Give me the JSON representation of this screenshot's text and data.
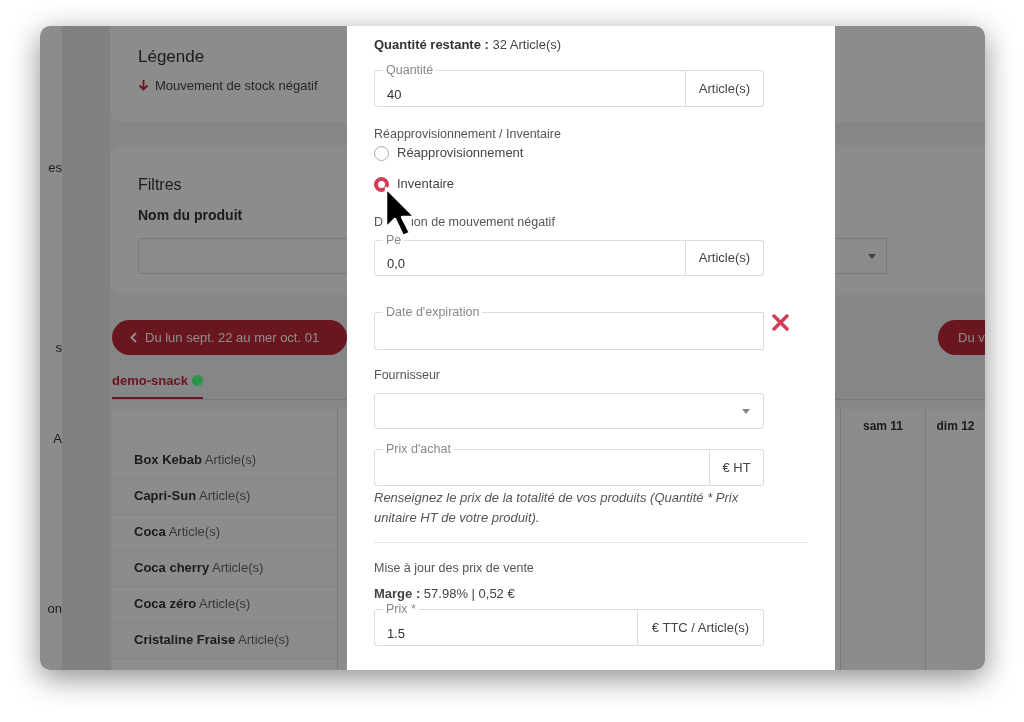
{
  "sidebar": {
    "items": [
      {
        "label": "es"
      },
      {
        "label": "s"
      },
      {
        "label": "A"
      },
      {
        "label": "on"
      }
    ]
  },
  "legend": {
    "title": "Légende",
    "items": [
      {
        "label": "Mouvement de stock négatif"
      }
    ]
  },
  "filters": {
    "title": "Filtres",
    "product_label": "Nom du produit"
  },
  "period": {
    "previous": "Du lun sept. 22 au mer oct. 01",
    "next": "Du v"
  },
  "tabs": [
    {
      "label": "demo-snack",
      "selected": true,
      "color": "#2e9448"
    }
  ],
  "table": {
    "columns": [
      "sam 11",
      "dim 12"
    ],
    "rows": [
      {
        "name": "Box Kebab",
        "unit": "Article(s)"
      },
      {
        "name": "Capri-Sun",
        "unit": "Article(s)"
      },
      {
        "name": "Coca",
        "unit": "Article(s)"
      },
      {
        "name": "Coca cherry",
        "unit": "Article(s)"
      },
      {
        "name": "Coca zéro",
        "unit": "Article(s)"
      },
      {
        "name": "Cristaline Fraise",
        "unit": "Article(s)"
      }
    ]
  },
  "modal": {
    "remaining": {
      "label": "Quantité restante :",
      "value": "32 Article(s)"
    },
    "quantity": {
      "label": "Quantité",
      "value": "40",
      "unit": "Article(s)"
    },
    "movement_type": {
      "label": "Réapprovisionnement / Inventaire",
      "options": [
        {
          "label": "Réapprovisionnement",
          "selected": false
        },
        {
          "label": "Inventaire",
          "selected": true
        }
      ]
    },
    "negative": {
      "heading_start": "D",
      "heading_end": "ion de mouvement négatif",
      "field_label": "Pe",
      "value": "0,0",
      "unit": "Article(s)"
    },
    "expiry": {
      "label": "Date d'expiration"
    },
    "supplier": {
      "label": "Fournisseur"
    },
    "purchase_price": {
      "label": "Prix d'achat",
      "unit": "€ HT",
      "help": "Renseignez le prix de la totalité de vos produits (Quantité * Prix unitaire HT de votre produit)."
    },
    "sale": {
      "title": "Mise à jour des prix de vente",
      "margin": "**Marge :** 57.98% | 0,52 €",
      "price_label": "Prix *",
      "price_value": "1.5",
      "price_unit": "€ TTC / Article(s)"
    }
  }
}
